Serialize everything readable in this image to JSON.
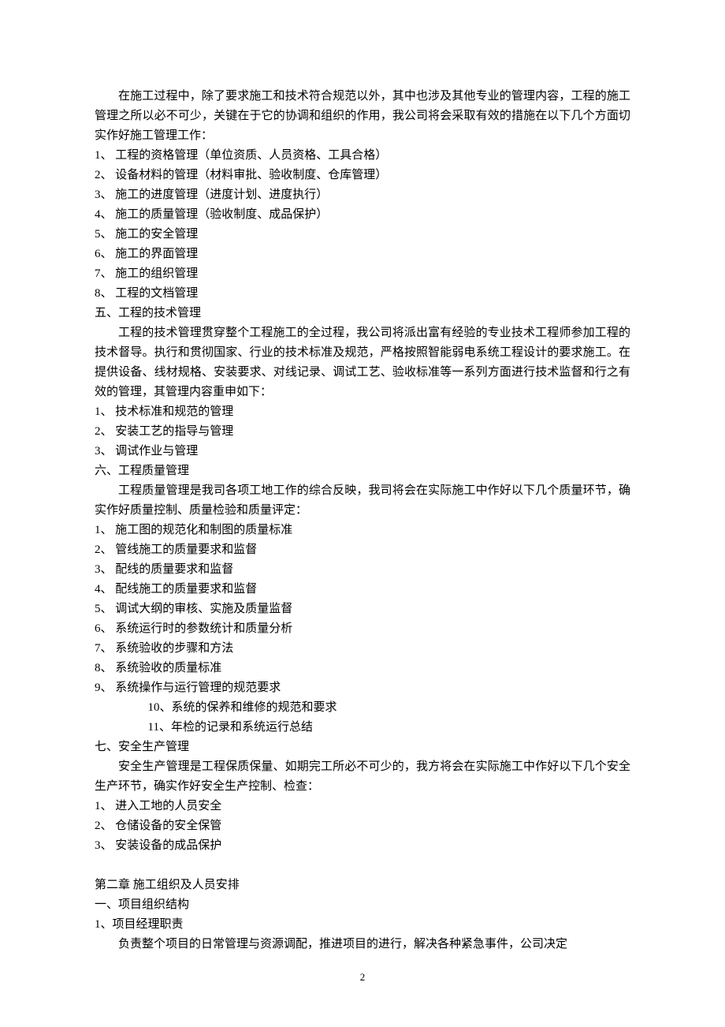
{
  "intro_para": "在施工过程中，除了要求施工和技术符合规范以外，其中也涉及其他专业的管理内容，工程的施工管理之所以必不可少，关键在于它的协调和组织的作用，我公司将会采取有效的措施在以下几个方面切实作好施工管理工作：",
  "section4_items": [
    "1、 工程的资格管理（单位资质、人员资格、工具合格）",
    "2、 设备材料的管理（材料审批、验收制度、仓库管理）",
    "3、 施工的进度管理（进度计划、进度执行）",
    "4、 施工的质量管理（验收制度、成品保护）",
    "5、 施工的安全管理",
    "6、 施工的界面管理",
    "7、 施工的组织管理",
    "8、 工程的文档管理"
  ],
  "section5_heading": "五、工程的技术管理",
  "section5_para": "工程的技术管理贯穿整个工程施工的全过程，我公司将派出富有经验的专业技术工程师参加工程的技术督导。执行和贯彻国家、行业的技术标准及规范，严格按照智能弱电系统工程设计的要求施工。在提供设备、线材规格、安装要求、对线记录、调试工艺、验收标准等一系列方面进行技术监督和行之有效的管理，其管理内容重申如下：",
  "section5_items": [
    "1、 技术标准和规范的管理",
    "2、 安装工艺的指导与管理",
    "3、 调试作业与管理"
  ],
  "section6_heading": "六、工程质量管理",
  "section6_para": "工程质量管理是我司各项工地工作的综合反映，我司将会在实际施工中作好以下几个质量环节，确实作好质量控制、质量检验和质量评定：",
  "section6_items": [
    "1、 施工图的规范化和制图的质量标准",
    "2、 管线施工的质量要求和监督",
    "3、 配线的质量要求和监督",
    "4、 配线施工的质量要求和监督",
    "5、 调试大纲的审核、实施及质量监督",
    "6、 系统运行时的参数统计和质量分析",
    "7、 系统验收的步骤和方法",
    "8、 系统验收的质量标准",
    "9、 系统操作与运行管理的规范要求"
  ],
  "section6_sub_items": [
    "10、系统的保养和维修的规范和要求",
    "11、年检的记录和系统运行总结"
  ],
  "section7_heading": "七、安全生产管理",
  "section7_para": "安全生产管理是工程保质保量、如期完工所必不可少的，我方将会在实际施工中作好以下几个安全生产环节，确实作好安全生产控制、检查：",
  "section7_items": [
    "1、 进入工地的人员安全",
    "2、 仓储设备的安全保管",
    "3、 安装设备的成品保护"
  ],
  "chapter2_heading": "第二章  施工组织及人员安排",
  "chapter2_sub1": "一、项目组织结构",
  "chapter2_sub2": "1、项目经理职责",
  "chapter2_para": "负责整个项目的日常管理与资源调配，推进项目的进行，解决各种紧急事件，公司决定",
  "page_number": "2"
}
